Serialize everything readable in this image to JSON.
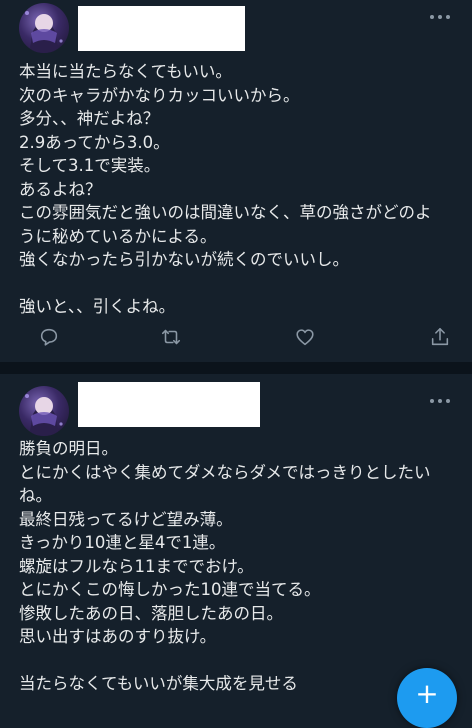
{
  "colors": {
    "background": "#15202b",
    "divider": "#0b131b",
    "text": "#e7e9ea",
    "icon": "#8b98a5",
    "accent": "#1d9bf0",
    "redaction": "#ffffff"
  },
  "tweets": [
    {
      "avatar_icon": "avatar-image",
      "author_redacted": true,
      "lines": [
        "本当に当たらなくてもいい。",
        "次のキャラがかなりカッコいいから。",
        "多分、、神だよね？",
        "2.9あってから3.0。",
        "そして3.1で実装。",
        "あるよね？",
        "この雰囲気だと強いのは間違いなく、草の強さがどのよ",
        "うに秘めているかによる。",
        "強くなかったら引かないが続くのでいいし。",
        "",
        "強いと、、引くよね。"
      ],
      "actions": [
        "reply-icon",
        "retweet-icon",
        "like-icon",
        "share-icon"
      ]
    },
    {
      "avatar_icon": "avatar-image",
      "author_redacted": true,
      "lines": [
        "勝負の明日。",
        "とにかくはやく集めてダメならダメではっきりとしたい",
        "ね。",
        "最終日残ってるけど望み薄。",
        "きっかり10連と星4で1連。",
        "螺旋はフルなら11まででおけ。",
        "とにかくこの悔しかった10連で当てる。",
        "惨敗したあの日、落胆したあの日。",
        "思い出すはあのすり抜け。",
        "",
        "当たらなくてもいいが集大成を見せる"
      ]
    }
  ],
  "compose_button": {
    "icon": "plus-icon",
    "glyph": "+"
  }
}
